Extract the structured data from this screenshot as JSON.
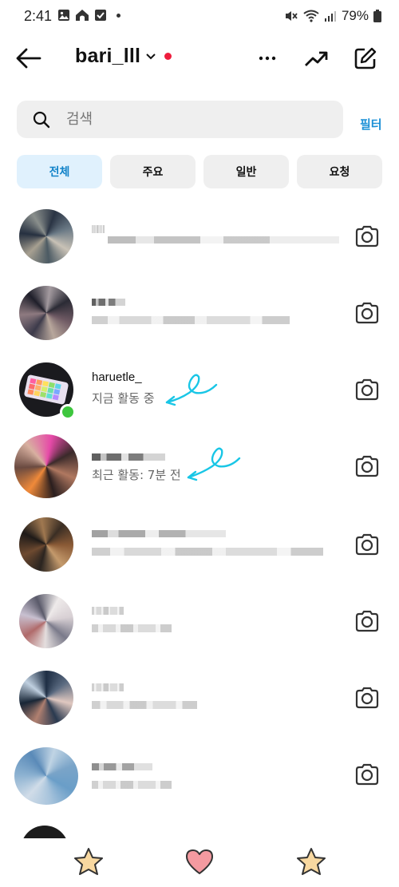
{
  "status": {
    "time": "2:41",
    "battery": "79%"
  },
  "header": {
    "account_name": "bari_lll",
    "icons": [
      "back-arrow-icon",
      "more-icon",
      "trending-icon",
      "compose-icon"
    ]
  },
  "search": {
    "placeholder": "검색",
    "filter_label": "필터"
  },
  "tabs": [
    {
      "label": "전체",
      "active": true
    },
    {
      "label": "주요",
      "active": false
    },
    {
      "label": "일반",
      "active": false
    },
    {
      "label": "요청",
      "active": false
    }
  ],
  "threads": [
    {
      "name": "",
      "status": "",
      "blurred": true
    },
    {
      "name": "",
      "status": "",
      "blurred": true
    },
    {
      "name": "haruetle_",
      "status": "지금 활동 중",
      "online": true
    },
    {
      "name": "",
      "status": "최근 활동: 7분 전",
      "blurred_name": true
    },
    {
      "name": "",
      "status": "",
      "blurred": true
    },
    {
      "name": "",
      "status": "",
      "blurred": true
    },
    {
      "name": "",
      "status": "",
      "blurred": true
    },
    {
      "name": "",
      "status": "",
      "blurred": true
    }
  ],
  "bottom_nav": [
    "star-icon",
    "heart-icon",
    "star-icon"
  ],
  "colors": {
    "accent": "#1283c9",
    "online": "#3ec63e",
    "notification": "#ee1d3d",
    "annotation": "#19c6e6"
  }
}
